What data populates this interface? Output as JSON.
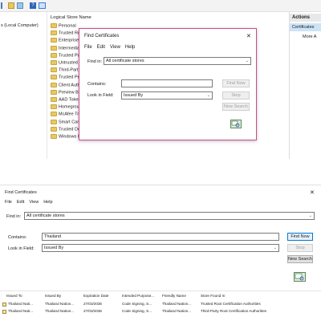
{
  "mmc": {
    "tree_root_label": "s (Local Computer)",
    "list_header": "Logical Store Name",
    "stores": [
      "Personal",
      "Trusted Ro",
      "Enterprise",
      "Intermedia",
      "Trusted Pu",
      "Untrusted",
      "Third-Part",
      "Trusted Pe",
      "Client Auth",
      "Preview Bu",
      "AAD Token",
      "Homegrou",
      "McAfee Tr",
      "Smart Car",
      "Trusted De",
      "Windows Live ID Token Issuer"
    ],
    "actions_header": "Actions",
    "actions_selected": "Certificates",
    "actions_more": "More A"
  },
  "small_dialog": {
    "title": "Find Certificates",
    "close_glyph": "✕",
    "menu": [
      "File",
      "Edit",
      "View",
      "Help"
    ],
    "find_in_label": "Find in:",
    "find_in_value": "All certificate stores",
    "contains_label": "Contains:",
    "contains_value": "",
    "look_in_label": "Look in Field:",
    "look_in_value": "Issued By",
    "find_now": "Find Now",
    "stop": "Stop",
    "new_search": "New Search"
  },
  "big_dialog": {
    "title": "Find Certificates",
    "close_glyph": "✕",
    "menu": [
      "File",
      "Edit",
      "View",
      "Help"
    ],
    "find_in_label": "Find in:",
    "find_in_value": "All certificate stores",
    "contains_label": "Contains:",
    "contains_value": "Thailand",
    "look_in_label": "Look in Field:",
    "look_in_value": "Issued By",
    "find_now": "Find Now",
    "stop": "Stop",
    "new_search": "New Search",
    "columns": [
      "Issued To",
      "Issued By",
      "Expiration Date",
      "Intended Purpose...",
      "Friendly Name",
      "Store Found In"
    ],
    "rows": [
      [
        "Thailand Nati...",
        "Thailand Nation...",
        "27/03/2036",
        "Code Signing, S...",
        "Thailand Nation...",
        "Trusted Root Certification Authorities"
      ],
      [
        "Thailand Nati...",
        "Thailand Nation...",
        "27/03/2036",
        "Code Signing, S...",
        "Thailand Nation...",
        "Third-Party Root Certification Authorities"
      ]
    ]
  },
  "colors": {
    "accent": "#0078d7",
    "dialog_border": "#c94f8a",
    "folder": "#e8c766"
  },
  "icons": {
    "search_result": "magnifier-certificate-icon",
    "certificate": "certificate-icon"
  }
}
